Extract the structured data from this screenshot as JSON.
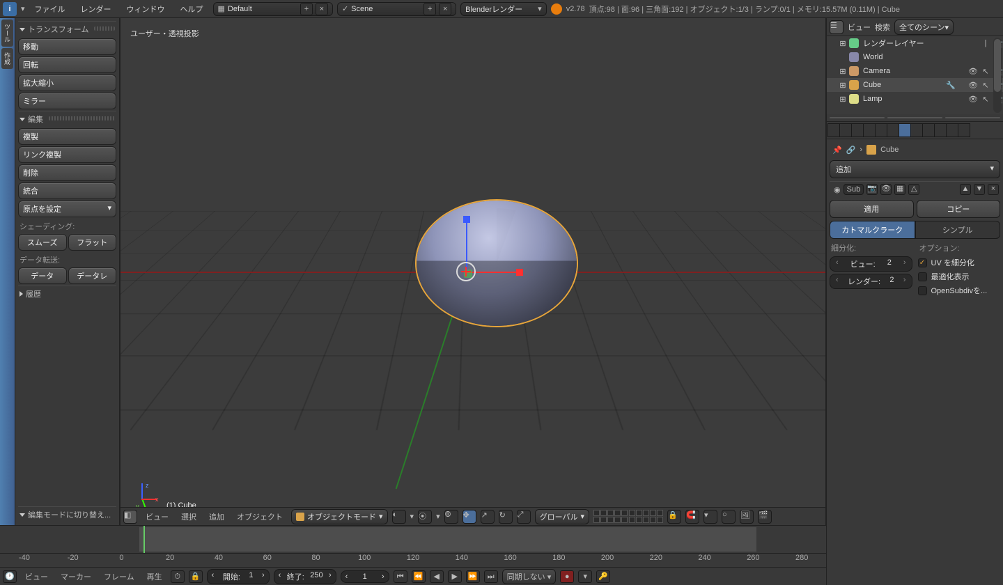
{
  "top": {
    "menus": [
      "ファイル",
      "レンダー",
      "ウィンドウ",
      "ヘルプ"
    ],
    "layout_label": "Default",
    "scene_label": "Scene",
    "engine": "Blenderレンダー",
    "version": "v2.78",
    "stats": "頂点:98 | 面:96 | 三角面:192 | オブジェクト:1/3 | ランプ:0/1 | メモリ:15.57M (0.11M) | Cube"
  },
  "toolshelf": {
    "transform_head": "トランスフォーム",
    "translate": "移動",
    "rotate": "回転",
    "scale": "拡大縮小",
    "mirror": "ミラー",
    "edit_head": "編集",
    "duplicate": "複製",
    "link_dup": "リンク複製",
    "delete": "削除",
    "join": "統合",
    "origin": "原点を設定",
    "shading_head": "シェーディング:",
    "smooth": "スムーズ",
    "flat": "フラット",
    "datatrans_head": "データ転送:",
    "data": "データ",
    "data_layout": "データレ",
    "history_head": "履歴",
    "bottom_switch": "編集モードに切り替え..."
  },
  "viewport": {
    "persp": "ユーザー・透視投影",
    "obj": "(1) Cube",
    "mode": "オブジェクトモード",
    "orient": "グローバル",
    "header_menus": [
      "ビュー",
      "選択",
      "追加",
      "オブジェクト"
    ]
  },
  "outliner": {
    "view": "ビュー",
    "search": "検索",
    "filter": "全てのシーン",
    "items": [
      {
        "name": "レンダーレイヤー",
        "exp": "⊞"
      },
      {
        "name": "World",
        "exp": ""
      },
      {
        "name": "Camera",
        "exp": "⊞"
      },
      {
        "name": "Cube",
        "exp": "⊞",
        "active": true
      },
      {
        "name": "Lamp",
        "exp": "⊞"
      }
    ]
  },
  "props": {
    "obj_name": "Cube",
    "add": "追加",
    "modifier_name": "Sub",
    "apply": "適用",
    "copy": "コピー",
    "catmull": "カトマルクラーク",
    "simple": "シンプル",
    "subdiv_label": "細分化:",
    "options_label": "オプション:",
    "view_label": "ビュー:",
    "view_val": "2",
    "render_label": "レンダー:",
    "render_val": "2",
    "uv_smooth": "UV を細分化",
    "optimal": "最適化表示",
    "opensubdiv": "OpenSubdivを..."
  },
  "timeline": {
    "ticks": [
      "-40",
      "-20",
      "0",
      "20",
      "40",
      "60",
      "80",
      "100",
      "120",
      "140",
      "160",
      "180",
      "200",
      "220",
      "240",
      "260",
      "280"
    ],
    "menus": [
      "ビュー",
      "マーカー",
      "フレーム",
      "再生"
    ],
    "start_label": "開始:",
    "start_val": "1",
    "end_label": "終了:",
    "end_val": "250",
    "current": "1",
    "sync": "同期しない"
  }
}
